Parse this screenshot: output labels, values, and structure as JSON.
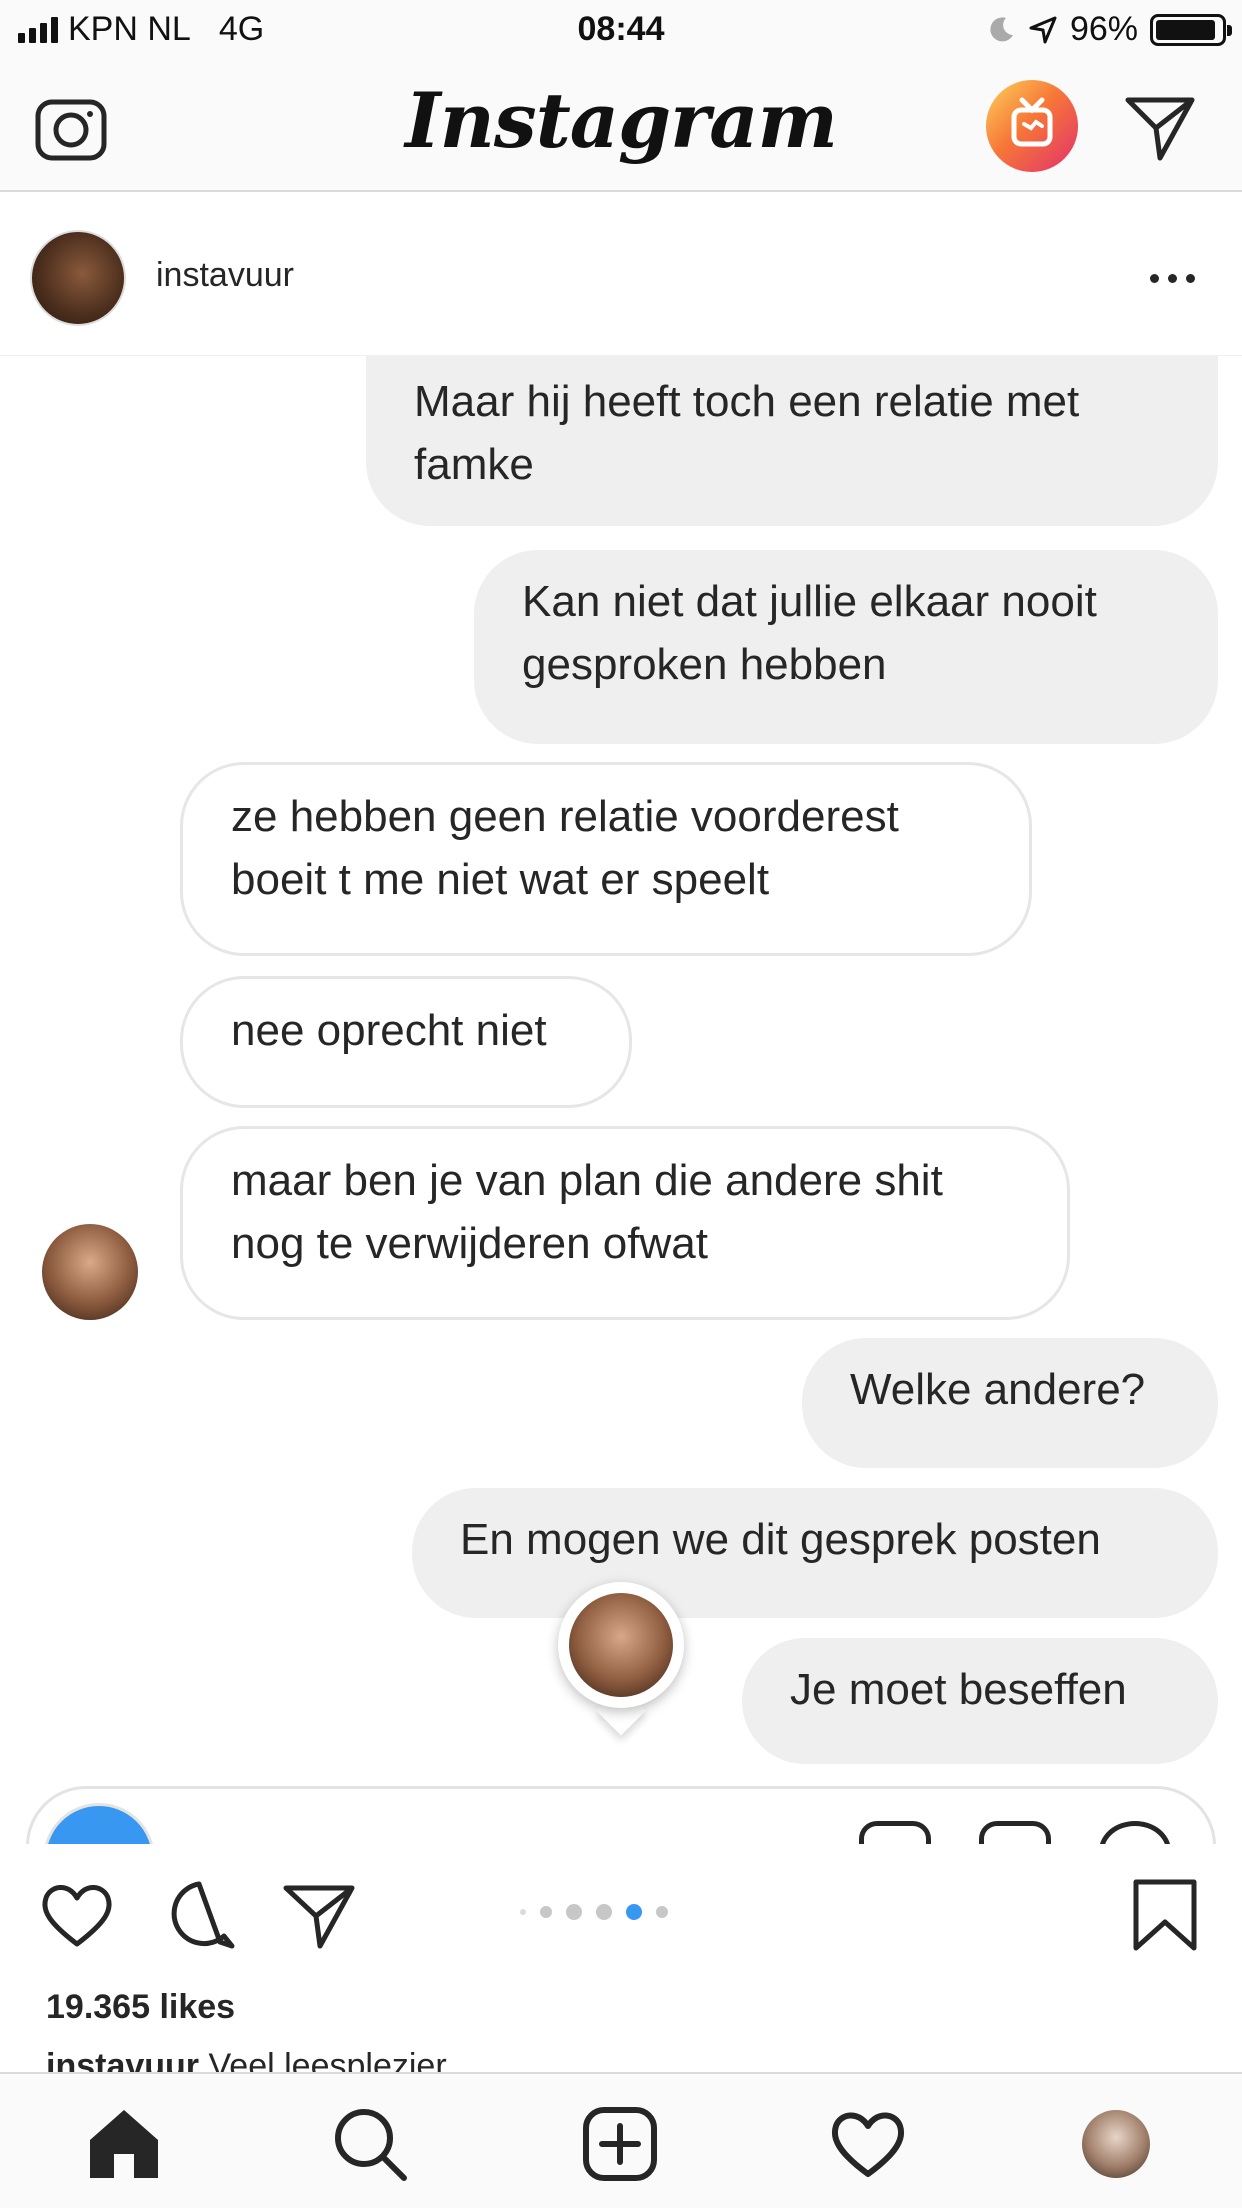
{
  "status_bar": {
    "carrier": "KPN NL",
    "network": "4G",
    "time": "08:44",
    "battery": "96%"
  },
  "header": {
    "logo": "Instagram",
    "icons": [
      "camera-icon",
      "igtv-icon",
      "direct-message-icon"
    ]
  },
  "post": {
    "username": "instavuur",
    "conversation": [
      {
        "direction": "out",
        "text": "Maar hij heeft toch een relatie met famke"
      },
      {
        "direction": "out",
        "text": "Kan niet dat jullie elkaar nooit gesproken hebben"
      },
      {
        "direction": "in",
        "text": "ze hebben geen relatie voorderest boeit t me niet wat er speelt"
      },
      {
        "direction": "in",
        "text": "nee oprecht niet"
      },
      {
        "direction": "in",
        "text": "maar ben je van plan die andere shit nog te verwijderen ofwat"
      },
      {
        "direction": "out",
        "text": "Welke andere?"
      },
      {
        "direction": "out",
        "text": "En mogen we dit gesprek posten"
      },
      {
        "direction": "out",
        "text": "Je moet beseffen"
      }
    ],
    "likes": "19.365 likes",
    "caption_user": "instavuur",
    "caption_text": "Veel leesplezier",
    "carousel": {
      "count": 6,
      "active_index": 4
    }
  },
  "colors": {
    "accent_blue": "#3897f0",
    "outgoing_bubble": "#efefef",
    "text": "#262626"
  }
}
